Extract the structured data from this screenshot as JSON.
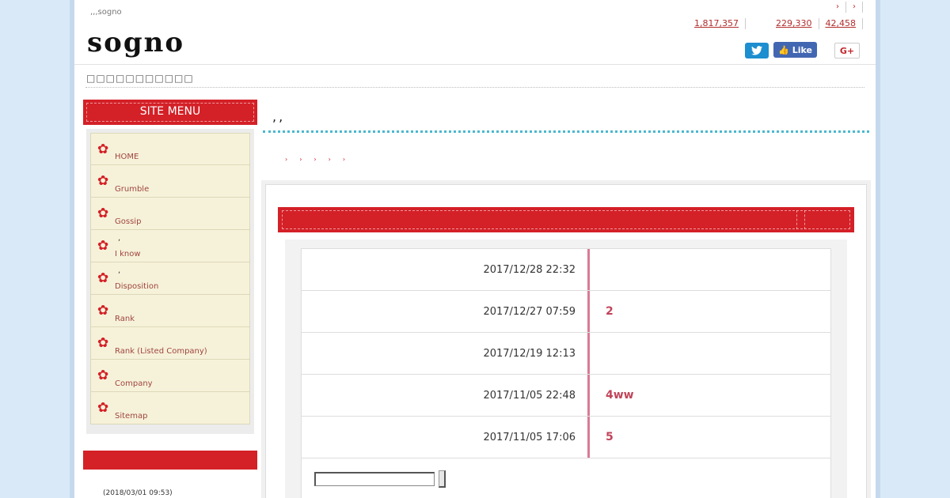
{
  "header": {
    "tagline": ",,,sogno",
    "logo_text": "sogno",
    "top_links": [
      "›",
      "›"
    ],
    "counts": [
      "1,817,357",
      "229,330",
      "42,458"
    ],
    "social": {
      "twitter_icon": "twitter-bird-icon",
      "facebook_label": "Like",
      "googleplus_label": "G+"
    },
    "breadcrumb_text": "□□□□□□□□□□□"
  },
  "sidebar": {
    "menu_title": "SITE MENU",
    "items": [
      {
        "line1": "",
        "label": "HOME"
      },
      {
        "line1": "",
        "label": "Grumble"
      },
      {
        "line1": "",
        "label": "Gossip"
      },
      {
        "line1": ",",
        "label": "I know"
      },
      {
        "line1": ",",
        "label": "Disposition"
      },
      {
        "line1": "",
        "label": "Rank"
      },
      {
        "line1": "",
        "label": "Rank (Listed Company)"
      },
      {
        "line1": "",
        "label": "Company"
      },
      {
        "line1": "",
        "label": "Sitemap"
      }
    ],
    "recent_date": "(2018/03/01 09:53)"
  },
  "main": {
    "title": ",,",
    "crumbs": [
      "›",
      "›",
      "›",
      "›",
      "›"
    ],
    "news": [
      {
        "date": "2017/12/28 22:32",
        "title": ""
      },
      {
        "date": "2017/12/27 07:59",
        "title": "2"
      },
      {
        "date": "2017/12/19 12:13",
        "title": ""
      },
      {
        "date": "2017/11/05 22:48",
        "title": "4ww"
      },
      {
        "date": "2017/11/05 17:06",
        "title": "5"
      }
    ],
    "search": {
      "value": "",
      "placeholder": ""
    }
  },
  "colors": {
    "accent_red": "#d42027",
    "link_pink": "#c1445a",
    "dotted_blue": "#4bb8cf",
    "menu_bg": "#f6f2da"
  }
}
